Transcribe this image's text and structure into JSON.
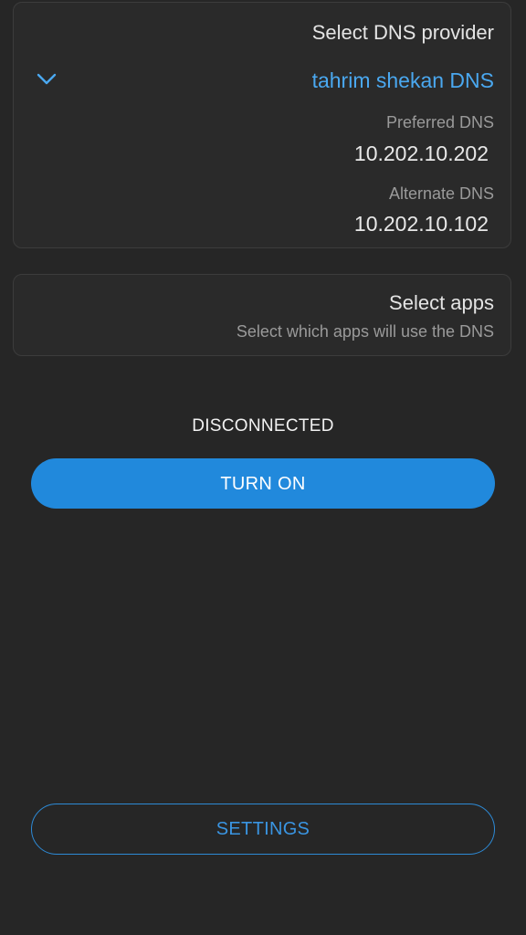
{
  "dns_card": {
    "title": "Select DNS provider",
    "expand_icon": "chevron-down-icon",
    "provider": "tahrim shekan DNS",
    "preferred_label": "Preferred DNS",
    "preferred_value": "10.202.10.202",
    "alternate_label": "Alternate DNS",
    "alternate_value": "10.202.10.102"
  },
  "apps_card": {
    "title": "Select apps",
    "subtitle": "Select which apps will use the DNS"
  },
  "status": {
    "text": "DISCONNECTED"
  },
  "buttons": {
    "turn_on_label": "TURN ON",
    "settings_label": "SETTINGS"
  },
  "colors": {
    "background": "#262626",
    "accent": "#2189dc",
    "provider_text": "#4aa8f0"
  }
}
